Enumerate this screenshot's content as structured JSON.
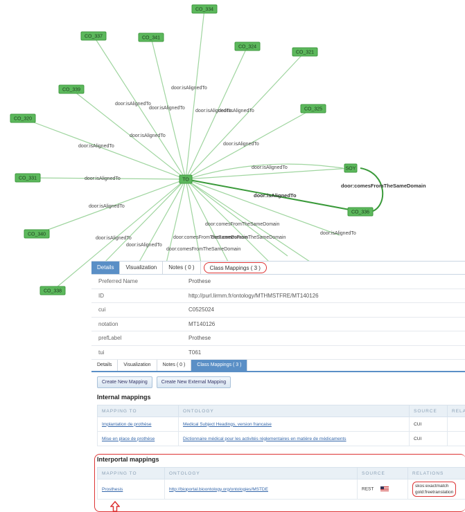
{
  "graph": {
    "center": "TO",
    "nodes": [
      "CO_334",
      "CO_337",
      "CO_341",
      "CO_324",
      "CO_321",
      "CO_339",
      "CO_325",
      "CO_320",
      "CO_331",
      "CO_340",
      "CO_338",
      "SOY",
      "CO_336"
    ],
    "edge_label": "door:isAlignedTo",
    "edge_label_bold": "door:isAlignedTo",
    "domain_label": "door:comesFromTheSameDomain",
    "domain_label_b": "door:comesFromTheSameDomain"
  },
  "panel1": {
    "tabs": [
      "Details",
      "Visualization",
      "Notes ( 0 )",
      "Class Mappings ( 3 )"
    ],
    "rows": [
      {
        "key": "Preferred Name",
        "value": "Prothese"
      },
      {
        "key": "ID",
        "value": "http://purl.lirmm.fr/ontology/MTHMSTFRE/MT140126"
      },
      {
        "key": "cui",
        "value": "C0525024"
      },
      {
        "key": "notation",
        "value": "MT140126"
      },
      {
        "key": "prefLabel",
        "value": "Prothese"
      },
      {
        "key": "tui",
        "value": "T061"
      }
    ]
  },
  "panel2": {
    "tabs": [
      "Details",
      "Visualization",
      "Notes ( 0 )",
      "Class Mappings ( 3 )"
    ],
    "buttons": [
      "Create New Mapping",
      "Create New External Mapping"
    ],
    "internal_title": "Internal mappings",
    "internal_headers": [
      "MAPPING TO",
      "ONTOLOGY",
      "SOURCE",
      "RELA"
    ],
    "internal_rows": [
      {
        "to": "Implantation de prothèse",
        "ontology": "Medical Subject Headings, version francaise",
        "source": "CUI"
      },
      {
        "to": "Mise en place de prothèse",
        "ontology": "Dictionnaire médical pour les activités réglementaires en matière de médicaments",
        "source": "CUI"
      }
    ],
    "interportal_title": "Interportal mappings",
    "interportal_headers": [
      "MAPPING TO",
      "ONTOLOGY",
      "SOURCE",
      "RELATIONS"
    ],
    "interportal_row": {
      "to": "Prosthesis",
      "ontology": "http://bioportal.bioontology.org/ontologies/MSTDE",
      "source": "REST",
      "relation1": "skos:exactmatch",
      "relation2": "gold:freetranslation"
    }
  },
  "colors": {
    "node": "#5cb85c",
    "tab_active": "#5a8fc6",
    "highlight": "#d33333"
  }
}
